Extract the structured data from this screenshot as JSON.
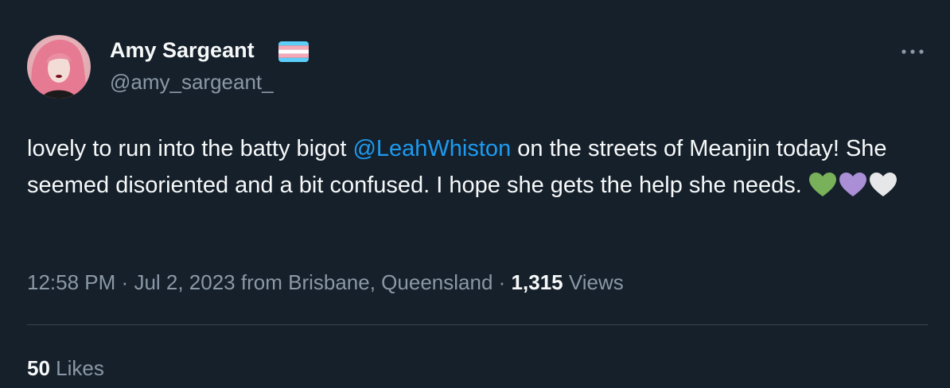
{
  "author": {
    "display_name": "Amy Sargeant",
    "handle": "@amy_sargeant_",
    "flag_icon": "transgender-flag-icon",
    "avatar_icon": "profile-photo-avatar"
  },
  "tweet": {
    "text_before_mention": "lovely to run into the batty bigot ",
    "mention": "@LeahWhiston",
    "text_after_mention": " on the streets of Meanjin today! She seemed disoriented and a bit confused. I hope she gets the help she needs. ",
    "emojis": [
      {
        "name": "green-heart-icon",
        "color": "#78b159"
      },
      {
        "name": "purple-heart-icon",
        "color": "#aa8ed6"
      },
      {
        "name": "white-heart-icon",
        "color": "#e6e7e8"
      }
    ]
  },
  "meta": {
    "time": "12:58 PM",
    "separator": "·",
    "date": "Jul 2, 2023",
    "location": "from Brisbane, Queensland",
    "views_count": "1,315",
    "views_label": "Views"
  },
  "stats": {
    "likes_count": "50",
    "likes_label": "Likes"
  },
  "colors": {
    "background": "#15202b",
    "primary_text": "#f7f9f9",
    "secondary_text": "#8b98a5",
    "link": "#1d9bf0",
    "divider": "#38444d"
  },
  "more_icon": "more-options-icon"
}
